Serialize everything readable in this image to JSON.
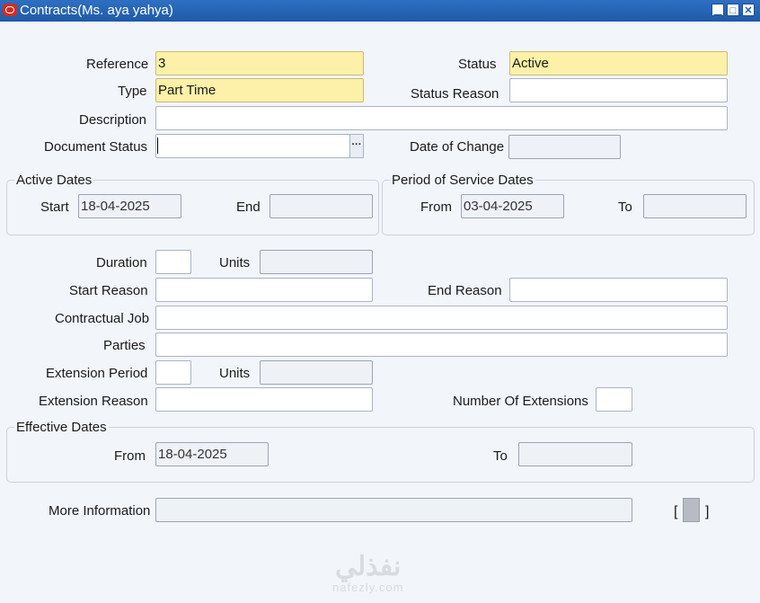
{
  "window": {
    "title": "Contracts(Ms. aya yahya)",
    "controls": [
      "minimize-icon",
      "maximize-icon",
      "close-icon"
    ]
  },
  "header": {
    "reference": {
      "label": "Reference",
      "value": "3"
    },
    "type": {
      "label": "Type",
      "value": "Part Time"
    },
    "description": {
      "label": "Description",
      "value": ""
    },
    "document_status": {
      "label": "Document Status",
      "value": ""
    },
    "status": {
      "label": "Status",
      "value": "Active"
    },
    "status_reason": {
      "label": "Status Reason",
      "value": ""
    },
    "date_of_change": {
      "label": "Date of Change",
      "value": ""
    }
  },
  "active_dates": {
    "title": "Active Dates",
    "start_label": "Start",
    "start_value": "18-04-2025",
    "end_label": "End",
    "end_value": ""
  },
  "service_dates": {
    "title": "Period of Service Dates",
    "from_label": "From",
    "from_value": "03-04-2025",
    "to_label": "To",
    "to_value": ""
  },
  "details": {
    "duration_label": "Duration",
    "duration_value": "",
    "units_label": "Units",
    "units_value": "",
    "start_reason_label": "Start Reason",
    "start_reason_value": "",
    "end_reason_label": "End Reason",
    "end_reason_value": "",
    "contractual_job_label": "Contractual Job",
    "contractual_job_value": "",
    "parties_label": "Parties",
    "parties_value": "",
    "extension_period_label": "Extension Period",
    "extension_period_value": "",
    "ext_units_label": "Units",
    "ext_units_value": "",
    "extension_reason_label": "Extension Reason",
    "extension_reason_value": "",
    "num_extensions_label": "Number Of Extensions",
    "num_extensions_value": ""
  },
  "effective_dates": {
    "title": "Effective Dates",
    "from_label": "From",
    "from_value": "18-04-2025",
    "to_label": "To",
    "to_value": ""
  },
  "more_info": {
    "label": "More Information",
    "value": "",
    "bracket_open": "[",
    "bracket_close": "]"
  },
  "watermark": {
    "arabic": "نفذلي",
    "latin": "nafezly.com"
  },
  "colors": {
    "titlebar": "#1f5aa8",
    "required_field": "#fdf0a8",
    "background": "#f2f5fa"
  }
}
